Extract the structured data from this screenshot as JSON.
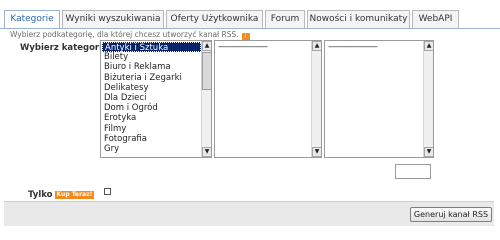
{
  "tabs": [
    {
      "label": "Kategorie",
      "active": true
    },
    {
      "label": "Wyniki wyszukiwania",
      "active": false
    },
    {
      "label": "Oferty Użytkownika",
      "active": false
    },
    {
      "label": "Forum",
      "active": false
    },
    {
      "label": "Nowości i komunikaty",
      "active": false
    },
    {
      "label": "WebAPI",
      "active": false
    }
  ],
  "hint": "Wybierz podkategorię, dla której chcesz utworzyć kanał RSS.",
  "rss_icon": "rss-icon",
  "category_label": "Wybierz kategorię",
  "categories": [
    "Antyki i Sztuka",
    "Bilety",
    "Biuro i Reklama",
    "Biżuteria i Zegarki",
    "Delikatesy",
    "Dla Dzieci",
    "Dom i Ogród",
    "Erotyka",
    "Filmy",
    "Fotografia",
    "Gry"
  ],
  "selected_category": "Antyki i Sztuka",
  "subcategory_placeholder": "--------------------------",
  "tylko_label": "Tylko",
  "tylko_badge": "Kup Teraz!",
  "tylko_checked": false,
  "generate_button": "Generuj kanał RSS",
  "colors": {
    "active_tab_text": "#2a63b3",
    "selection": "#0a246a",
    "badge": "#f28a1e",
    "footer_bg": "#e9e9e9"
  }
}
